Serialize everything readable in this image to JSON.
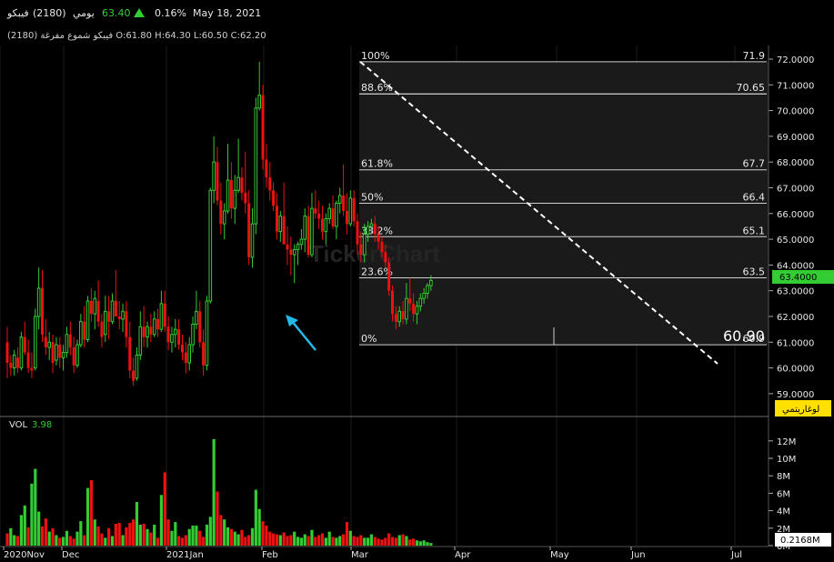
{
  "header": {
    "name": "فيبكو",
    "code": "(2180)",
    "period": "يومي",
    "last_price": "63.40",
    "change_pct": "0.16%",
    "date": "May 18, 2021",
    "ohlc_line": "فيبكو شموع مفرغة (2180) O:61.80 H:64.30 L:60.50 C:62.20"
  },
  "price_panel": {
    "price_tag": "63.4000",
    "annotation_value": "60.90",
    "log_button": "لوغاريتمي",
    "watermark": "TickerChart"
  },
  "volume_panel": {
    "label": "VOL",
    "value": "3.98",
    "volume_tag": "0.2168M"
  },
  "chart_data": [
    {
      "type": "candlestick",
      "ylim": [
        59.5,
        72.2
      ],
      "y_ticks": [
        "72.0000",
        "71.0000",
        "70.0000",
        "69.0000",
        "68.0000",
        "67.0000",
        "66.0000",
        "65.0000",
        "64.0000",
        "63.0000",
        "62.0000",
        "61.0000",
        "60.0000",
        "59.0000"
      ],
      "x_ticks": [
        "2020Nov",
        "Dec",
        "2021Jan",
        "Feb",
        "Mar",
        "Apr",
        "May",
        "Jun",
        "Jul"
      ],
      "fibonacci": [
        {
          "level": "100%",
          "price": "71.9",
          "value": 71.9
        },
        {
          "level": "88.6%",
          "price": "70.65",
          "value": 70.65
        },
        {
          "level": "61.8%",
          "price": "67.7",
          "value": 67.7
        },
        {
          "level": "50%",
          "price": "66.4",
          "value": 66.4
        },
        {
          "level": "38.2%",
          "price": "65.1",
          "value": 65.1
        },
        {
          "level": "23.6%",
          "price": "63.5",
          "value": 63.5
        },
        {
          "level": "0%",
          "price": "60.9",
          "value": 60.9
        }
      ],
      "colors": {
        "up": "#33cc33",
        "down": "#ee1111",
        "fib_line": "#cfcfcf",
        "trend_line": "#ffffff",
        "arrow": "#22b8e8",
        "price_tag": "#33cc33",
        "log_button": "#ffe000"
      },
      "candles": [
        [
          61,
          61.6,
          59.6,
          60.2
        ],
        [
          60.2,
          60.5,
          59.7,
          60.0
        ],
        [
          60.0,
          60.7,
          59.7,
          60.5
        ],
        [
          60.4,
          60.8,
          59.8,
          60.0
        ],
        [
          60.0,
          61.4,
          59.9,
          61.2
        ],
        [
          61.2,
          61.8,
          60.5,
          60.6
        ],
        [
          60.6,
          61.1,
          59.8,
          60.0
        ],
        [
          60.0,
          60.6,
          59.6,
          59.9
        ],
        [
          60.0,
          62.3,
          59.9,
          62.0
        ],
        [
          62.0,
          63.9,
          61.5,
          63.1
        ],
        [
          63.1,
          63.8,
          61.0,
          61.3
        ],
        [
          61.2,
          61.9,
          60.5,
          60.8
        ],
        [
          60.8,
          61.4,
          60.3,
          61.0
        ],
        [
          61.0,
          61.3,
          59.8,
          60.2
        ],
        [
          60.3,
          61.2,
          60.1,
          60.9
        ],
        [
          60.9,
          61.2,
          60.0,
          60.4
        ],
        [
          60.4,
          60.9,
          59.9,
          60.6
        ],
        [
          60.6,
          61.6,
          60.4,
          61.3
        ],
        [
          61.3,
          61.8,
          60.5,
          60.8
        ],
        [
          60.8,
          61.2,
          59.8,
          60.1
        ],
        [
          60.1,
          61.1,
          60.0,
          60.9
        ],
        [
          60.9,
          62.1,
          60.8,
          61.8
        ],
        [
          61.8,
          62.4,
          60.8,
          61.1
        ],
        [
          61.1,
          62.8,
          61.0,
          62.6
        ],
        [
          62.6,
          63.1,
          61.8,
          62.1
        ],
        [
          62.1,
          63.0,
          61.5,
          62.7
        ],
        [
          62.6,
          63.4,
          61.6,
          61.8
        ],
        [
          61.8,
          62.1,
          60.8,
          61.2
        ],
        [
          61.3,
          62.8,
          61.0,
          62.2
        ],
        [
          62.2,
          62.8,
          61.1,
          61.8
        ],
        [
          61.8,
          62.9,
          61.7,
          62.6
        ],
        [
          62.6,
          63.8,
          62.3,
          62.0
        ],
        [
          62.0,
          62.6,
          61.5,
          61.9
        ],
        [
          61.9,
          62.5,
          61.4,
          62.2
        ],
        [
          62.2,
          62.6,
          60.8,
          61.2
        ],
        [
          61.2,
          61.8,
          59.6,
          59.9
        ],
        [
          59.9,
          60.4,
          59.3,
          59.5
        ],
        [
          59.6,
          60.8,
          59.5,
          60.5
        ],
        [
          60.5,
          62.2,
          60.3,
          61.6
        ],
        [
          61.6,
          62.4,
          60.8,
          61.2
        ],
        [
          61.2,
          61.8,
          60.8,
          61.6
        ],
        [
          61.6,
          62.1,
          61.0,
          61.3
        ],
        [
          61.3,
          62.2,
          61.2,
          61.9
        ],
        [
          61.9,
          62.3,
          61.2,
          61.5
        ],
        [
          61.5,
          63.0,
          61.4,
          62.5
        ],
        [
          62.5,
          63.0,
          61.4,
          61.6
        ],
        [
          61.6,
          62.0,
          60.7,
          61.0
        ],
        [
          61.0,
          61.6,
          60.6,
          61.3
        ],
        [
          61.3,
          61.9,
          60.8,
          61.5
        ],
        [
          61.5,
          61.9,
          60.7,
          60.9
        ],
        [
          60.9,
          61.3,
          60.3,
          60.6
        ],
        [
          60.6,
          61.0,
          59.8,
          60.2
        ],
        [
          60.2,
          61.2,
          59.9,
          60.9
        ],
        [
          60.9,
          62.0,
          60.6,
          61.7
        ],
        [
          61.7,
          63.0,
          61.5,
          62.2
        ],
        [
          62.2,
          62.6,
          60.8,
          61.0
        ],
        [
          61.0,
          61.5,
          59.7,
          60.1
        ],
        [
          60.1,
          62.8,
          59.9,
          62.6
        ],
        [
          62.6,
          67.0,
          62.5,
          66.9
        ],
        [
          66.9,
          69.0,
          66.4,
          68.0
        ],
        [
          68.0,
          68.6,
          66.3,
          66.5
        ],
        [
          66.5,
          67.2,
          65.2,
          65.6
        ],
        [
          65.6,
          66.4,
          65.0,
          66.1
        ],
        [
          66.1,
          68.7,
          66.0,
          67.3
        ],
        [
          67.3,
          68.0,
          65.8,
          66.2
        ],
        [
          66.2,
          67.5,
          65.6,
          66.9
        ],
        [
          66.9,
          68.9,
          66.8,
          67.4
        ],
        [
          67.4,
          67.8,
          66.5,
          66.8
        ],
        [
          66.8,
          68.4,
          66.0,
          66.4
        ],
        [
          66.4,
          66.9,
          64.0,
          64.3
        ],
        [
          64.3,
          66.2,
          63.9,
          65.6
        ],
        [
          65.6,
          70.5,
          65.2,
          70.1
        ],
        [
          70.1,
          71.9,
          70.0,
          70.6
        ],
        [
          70.6,
          71.0,
          67.7,
          68.1
        ],
        [
          68.1,
          68.7,
          67.0,
          67.4
        ],
        [
          67.4,
          68.0,
          66.5,
          66.9
        ],
        [
          66.9,
          67.2,
          66.1,
          66.3
        ],
        [
          66.3,
          66.8,
          65.0,
          65.3
        ],
        [
          65.3,
          66.1,
          64.9,
          65.9
        ],
        [
          65.9,
          67.2,
          65.3,
          64.8
        ],
        [
          64.8,
          65.5,
          64.0,
          64.6
        ],
        [
          64.6,
          65.1,
          63.6,
          64.4
        ],
        [
          64.4,
          64.8,
          63.3,
          64.6
        ],
        [
          64.6,
          64.9,
          64.0,
          64.8
        ],
        [
          64.8,
          65.4,
          64.6,
          65.0
        ],
        [
          65.0,
          66.2,
          64.5,
          65.9
        ],
        [
          65.9,
          66.3,
          64.3,
          64.4
        ],
        [
          64.4,
          66.8,
          64.3,
          66.2
        ],
        [
          66.2,
          66.9,
          65.8,
          66.0
        ],
        [
          66.0,
          66.5,
          65.4,
          65.8
        ],
        [
          65.8,
          66.3,
          65.0,
          65.3
        ],
        [
          65.3,
          66.0,
          64.8,
          65.8
        ],
        [
          65.8,
          66.4,
          65.6,
          66.2
        ],
        [
          66.2,
          66.7,
          65.4,
          65.5
        ],
        [
          65.5,
          66.5,
          65.0,
          66.4
        ],
        [
          66.4,
          67.0,
          66.0,
          66.7
        ],
        [
          66.7,
          67.9,
          65.9,
          66.1
        ],
        [
          66.1,
          66.8,
          65.2,
          65.6
        ],
        [
          65.6,
          66.9,
          65.5,
          66.6
        ],
        [
          66.6,
          66.9,
          65.5,
          65.7
        ],
        [
          65.7,
          66.0,
          64.4,
          64.8
        ],
        [
          64.8,
          65.3,
          64.1,
          64.4
        ],
        [
          64.4,
          65.6,
          64.1,
          65.2
        ],
        [
          65.2,
          65.7,
          64.9,
          65.5
        ],
        [
          65.5,
          65.8,
          65.2,
          65.6
        ],
        [
          65.6,
          65.9,
          64.9,
          65.2
        ],
        [
          65.2,
          65.5,
          64.6,
          64.9
        ],
        [
          64.9,
          65.1,
          64.3,
          64.5
        ],
        [
          64.5,
          64.8,
          63.9,
          64.1
        ],
        [
          64.1,
          64.3,
          62.8,
          63.0
        ],
        [
          63.0,
          63.2,
          61.8,
          62.1
        ],
        [
          62.1,
          62.4,
          61.5,
          61.8
        ],
        [
          61.8,
          62.4,
          61.6,
          62.2
        ],
        [
          62.2,
          62.6,
          61.7,
          61.9
        ],
        [
          61.9,
          63.3,
          61.7,
          62.7
        ],
        [
          62.7,
          63.5,
          62.2,
          62.5
        ],
        [
          62.5,
          62.9,
          61.8,
          62.1
        ],
        [
          62.1,
          62.6,
          61.7,
          62.4
        ],
        [
          62.4,
          62.9,
          62.2,
          62.7
        ],
        [
          62.7,
          63.1,
          62.5,
          62.9
        ],
        [
          62.9,
          63.3,
          62.7,
          63.2
        ],
        [
          63.2,
          63.6,
          63.0,
          63.4
        ]
      ]
    },
    {
      "type": "bar",
      "title": "VOL",
      "ylim": [
        0,
        12.5
      ],
      "y_ticks": [
        "12M",
        "10M",
        "8M",
        "6M",
        "4M",
        "2M",
        "0M"
      ],
      "values": [
        1.4,
        2.0,
        1.2,
        1.1,
        3.5,
        4.6,
        2.1,
        7.1,
        8.8,
        3.9,
        2.2,
        3.1,
        1.6,
        2.0,
        1.2,
        0.9,
        1.0,
        1.7,
        1.1,
        0.8,
        1.6,
        2.8,
        1.2,
        6.6,
        7.5,
        3.0,
        2.2,
        1.4,
        0.9,
        2.0,
        1.1,
        2.5,
        2.6,
        1.2,
        2.1,
        2.6,
        3.0,
        5.0,
        2.4,
        2.5,
        1.9,
        1.5,
        2.4,
        0.9,
        5.8,
        8.4,
        3.0,
        1.7,
        2.7,
        1.1,
        0.9,
        1.2,
        1.9,
        2.3,
        2.3,
        1.7,
        1.0,
        2.4,
        3.3,
        12.2,
        6.2,
        3.5,
        3.0,
        2.1,
        1.9,
        1.6,
        1.3,
        1.8,
        1.0,
        1.2,
        2.0,
        6.4,
        4.2,
        2.8,
        2.3,
        1.6,
        1.4,
        1.3,
        1.2,
        1.5,
        1.1,
        1.2,
        1.6,
        1.0,
        0.9,
        1.3,
        1.1,
        1.8,
        1.0,
        1.2,
        1.4,
        0.9,
        1.6,
        1.0,
        0.9,
        1.1,
        1.3,
        2.7,
        1.7,
        1.1,
        1.0,
        1.2,
        0.9,
        0.9,
        1.3,
        1.0,
        0.8,
        0.7,
        0.9,
        1.4,
        1.0,
        0.9,
        1.2,
        1.3,
        1.1,
        0.7,
        0.8,
        0.6,
        0.5,
        0.6,
        0.4,
        0.3
      ],
      "up_flags": [
        0,
        1,
        1,
        0,
        1,
        1,
        0,
        1,
        1,
        1,
        0,
        0,
        1,
        0,
        1,
        0,
        1,
        1,
        0,
        0,
        1,
        1,
        0,
        1,
        0,
        1,
        0,
        0,
        1,
        0,
        1,
        0,
        0,
        1,
        0,
        0,
        0,
        1,
        1,
        0,
        1,
        0,
        1,
        0,
        1,
        0,
        0,
        1,
        1,
        0,
        0,
        0,
        1,
        1,
        1,
        0,
        0,
        1,
        1,
        1,
        0,
        0,
        1,
        1,
        0,
        1,
        1,
        0,
        0,
        0,
        1,
        1,
        1,
        0,
        0,
        0,
        0,
        0,
        1,
        0,
        0,
        0,
        1,
        1,
        1,
        1,
        0,
        1,
        0,
        0,
        0,
        1,
        1,
        0,
        1,
        1,
        0,
        0,
        1,
        0,
        0,
        0,
        1,
        1,
        1,
        0,
        0,
        0,
        0,
        0,
        0,
        0,
        1,
        0,
        1,
        0,
        0,
        1,
        1,
        1,
        1,
        1
      ]
    }
  ]
}
